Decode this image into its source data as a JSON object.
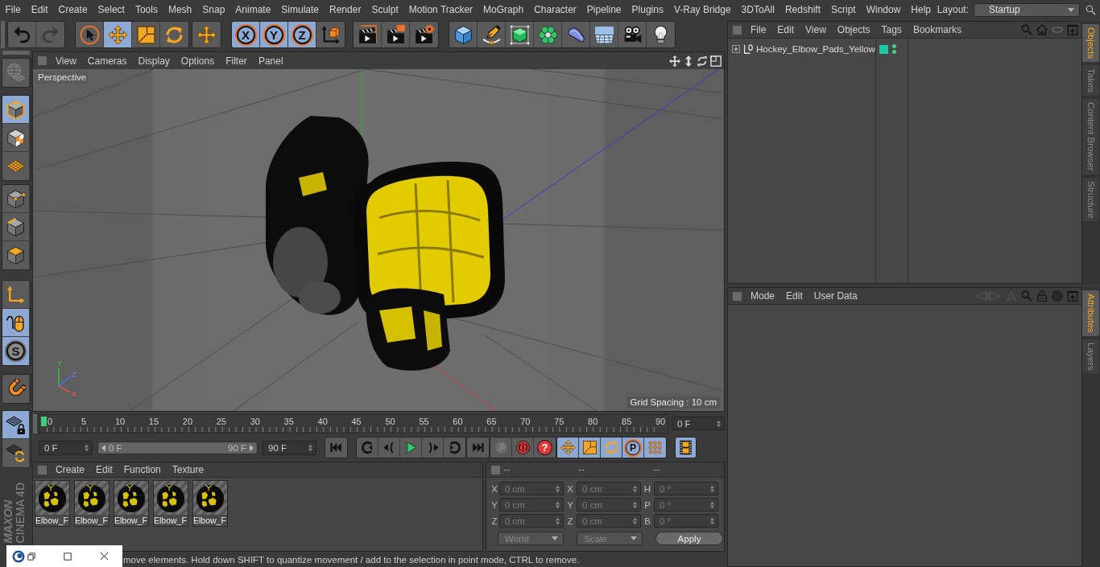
{
  "menu_bar": {
    "items": [
      "File",
      "Edit",
      "Create",
      "Select",
      "Tools",
      "Mesh",
      "Snap",
      "Animate",
      "Simulate",
      "Render",
      "Sculpt",
      "Motion Tracker",
      "MoGraph",
      "Character",
      "Pipeline",
      "Plugins",
      "V-Ray Bridge",
      "3DToAll",
      "Redshift",
      "Script",
      "Window",
      "Help"
    ],
    "layout_label": "Layout:",
    "layout_value": "Startup"
  },
  "toolbar": {
    "groups": [
      [
        {
          "selected": false,
          "disabled": false
        },
        {
          "selected": false,
          "disabled": true
        }
      ],
      [
        {
          "selected": false,
          "disabled": false
        },
        {
          "selected": true,
          "disabled": false
        },
        {
          "selected": false,
          "disabled": false
        },
        {
          "selected": false,
          "disabled": false
        }
      ],
      [
        {
          "selected": false,
          "disabled": false
        }
      ],
      [
        {
          "label": "X",
          "selected": true,
          "disabled": false
        },
        {
          "label": "Y",
          "selected": true,
          "disabled": false
        },
        {
          "label": "Z",
          "selected": true,
          "disabled": false
        },
        {
          "selected": false,
          "disabled": false
        }
      ],
      [
        {
          "selected": false,
          "disabled": false
        },
        {
          "selected": false,
          "disabled": false
        },
        {
          "selected": false,
          "disabled": false
        }
      ],
      [
        {
          "selected": false,
          "disabled": false
        },
        {
          "selected": false,
          "disabled": false
        },
        {
          "selected": false,
          "disabled": false
        },
        {
          "selected": false,
          "disabled": false
        },
        {
          "selected": false,
          "disabled": false
        },
        {
          "selected": false,
          "disabled": false
        },
        {
          "selected": false,
          "disabled": false
        },
        {
          "selected": false,
          "disabled": false
        }
      ]
    ]
  },
  "objects_panel": {
    "menu": [
      "File",
      "Edit",
      "View",
      "Objects",
      "Tags",
      "Bookmarks"
    ],
    "objects": [
      {
        "name": "Hockey_Elbow_Pads_Yellow",
        "expanded": false,
        "color": "#1ec8a0",
        "editor_visible": true,
        "render_visible": true
      }
    ],
    "tabs": [
      {
        "label": "Objects",
        "selected": true
      },
      {
        "label": "Takes",
        "selected": false
      },
      {
        "label": "Content Browser",
        "selected": false
      },
      {
        "label": "Structure",
        "selected": false
      }
    ]
  },
  "left_toolbar": {
    "groups": [
      [
        {
          "selected": false,
          "disabled": true
        }
      ],
      [
        {
          "selected": true,
          "disabled": false
        },
        {
          "selected": false,
          "disabled": false
        },
        {
          "selected": false,
          "disabled": false
        }
      ],
      [
        {
          "selected": false,
          "disabled": false
        },
        {
          "selected": false,
          "disabled": false
        },
        {
          "selected": false,
          "disabled": false
        }
      ],
      [
        {
          "selected": false,
          "disabled": false
        },
        {
          "selected": true,
          "disabled": false
        },
        {
          "label": "S",
          "selected": true,
          "disabled": false
        }
      ],
      [
        {
          "selected": false,
          "disabled": false
        }
      ],
      [
        {
          "selected": true,
          "disabled": false
        },
        {
          "selected": false,
          "disabled": false
        }
      ]
    ],
    "logo": {
      "brand": "MAXON",
      "product": "CINEMA 4D"
    }
  },
  "viewport": {
    "menu": [
      "View",
      "Cameras",
      "Display",
      "Options",
      "Filter",
      "Panel"
    ],
    "camera": "Perspective",
    "axis_labels": [
      "Y",
      "Z",
      "X"
    ],
    "grid_spacing": "Grid Spacing : 10 cm"
  },
  "attributes_panel": {
    "menu": [
      "Mode",
      "Edit",
      "User Data"
    ],
    "tabs": [
      {
        "label": "Attributes",
        "selected": true
      },
      {
        "label": "Layers",
        "selected": false
      }
    ]
  },
  "timeline": {
    "labels": [
      "0",
      "5",
      "10",
      "15",
      "20",
      "25",
      "30",
      "35",
      "40",
      "45",
      "50",
      "55",
      "60",
      "65",
      "70",
      "75",
      "80",
      "85",
      "90"
    ],
    "level": 0,
    "current_frame": "0 F",
    "start_frame": "0 F",
    "range": {
      "start": "0 F",
      "end": "90 F",
      "level": 1
    },
    "end_frame": "90 F",
    "record_buttons": [
      {
        "disabled": true
      },
      {
        "disabled": false
      },
      {
        "label": "?",
        "disabled": false
      }
    ],
    "key_buttons": [
      {
        "selected": true
      },
      {
        "selected": true
      },
      {
        "selected": true
      },
      {
        "label": "P",
        "selected": true
      },
      {
        "selected": true
      }
    ],
    "timeline_button": {
      "selected": true
    }
  },
  "material_manager": {
    "menu": [
      "Create",
      "Edit",
      "Function",
      "Texture"
    ],
    "materials": [
      {
        "name": "Elbow_F",
        "selected": false
      },
      {
        "name": "Elbow_F",
        "selected": false
      },
      {
        "name": "Elbow_F",
        "selected": false
      },
      {
        "name": "Elbow_F",
        "selected": false
      },
      {
        "name": "Elbow_F",
        "selected": false
      }
    ]
  },
  "coordinates": {
    "headers": [
      "--",
      "--",
      "--"
    ],
    "columns": [
      [
        {
          "axis": "X",
          "value": "0 cm"
        },
        {
          "axis": "Y",
          "value": "0 cm"
        },
        {
          "axis": "Z",
          "value": "0 cm"
        }
      ],
      [
        {
          "axis": "X",
          "value": "0 cm"
        },
        {
          "axis": "Y",
          "value": "0 cm"
        },
        {
          "axis": "Z",
          "value": "0 cm"
        }
      ],
      [
        {
          "axis": "H",
          "value": "0 °"
        },
        {
          "axis": "P",
          "value": "0 °"
        },
        {
          "axis": "B",
          "value": "0 °"
        }
      ]
    ],
    "dropdowns": [
      "World",
      "Scale"
    ],
    "apply": "Apply"
  },
  "status_bar": {
    "text": "move elements. Hold down SHIFT to quantize movement / add to the selection in point mode, CTRL to remove."
  }
}
